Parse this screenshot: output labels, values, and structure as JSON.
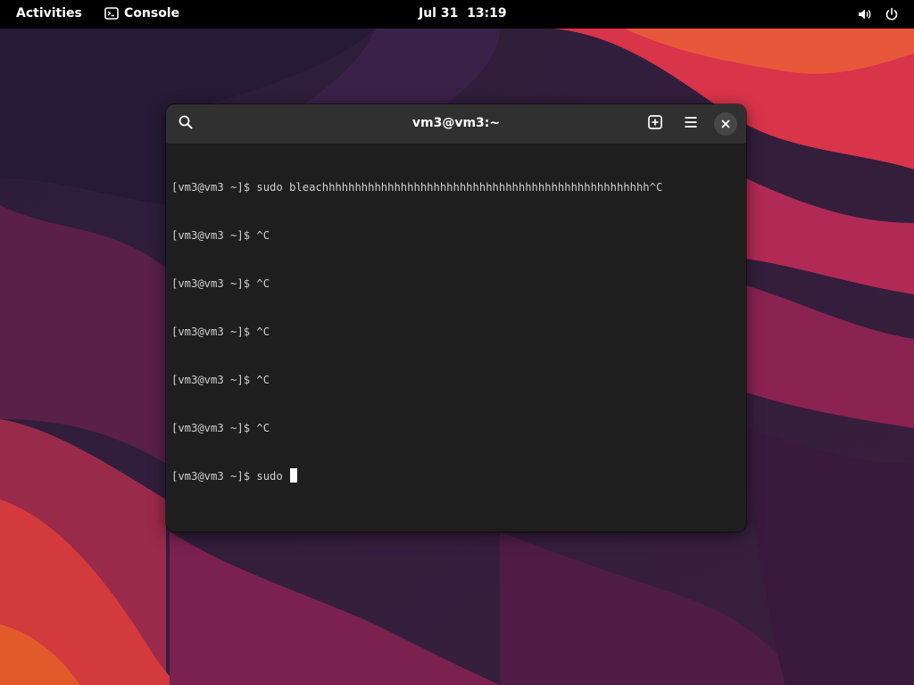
{
  "topbar": {
    "activities_label": "Activities",
    "app_name": "Console",
    "app_icon": "terminal-icon",
    "clock": "Jul 31  13:19",
    "tray_icons": [
      "volume-icon",
      "power-icon"
    ]
  },
  "window": {
    "title": "vm3@vm3:~",
    "buttons": {
      "search": "search-icon",
      "new_tab": "new-tab-icon",
      "menu": "hamburger-menu-icon",
      "close": "close-icon"
    }
  },
  "terminal": {
    "lines": [
      "[vm3@vm3 ~]$ sudo bleachhhhhhhhhhhhhhhhhhhhhhhhhhhhhhhhhhhhhhhhhhhhhhhhhh^C",
      "[vm3@vm3 ~]$ ^C",
      "[vm3@vm3 ~]$ ^C",
      "[vm3@vm3 ~]$ ^C",
      "[vm3@vm3 ~]$ ^C",
      "[vm3@vm3 ~]$ ^C",
      "[vm3@vm3 ~]$ sudo "
    ]
  },
  "colors": {
    "topbar_bg": "#000000",
    "window_bg": "#1e1e1e",
    "headerbar_bg": "#303030",
    "terminal_text": "#d0d0d0"
  }
}
